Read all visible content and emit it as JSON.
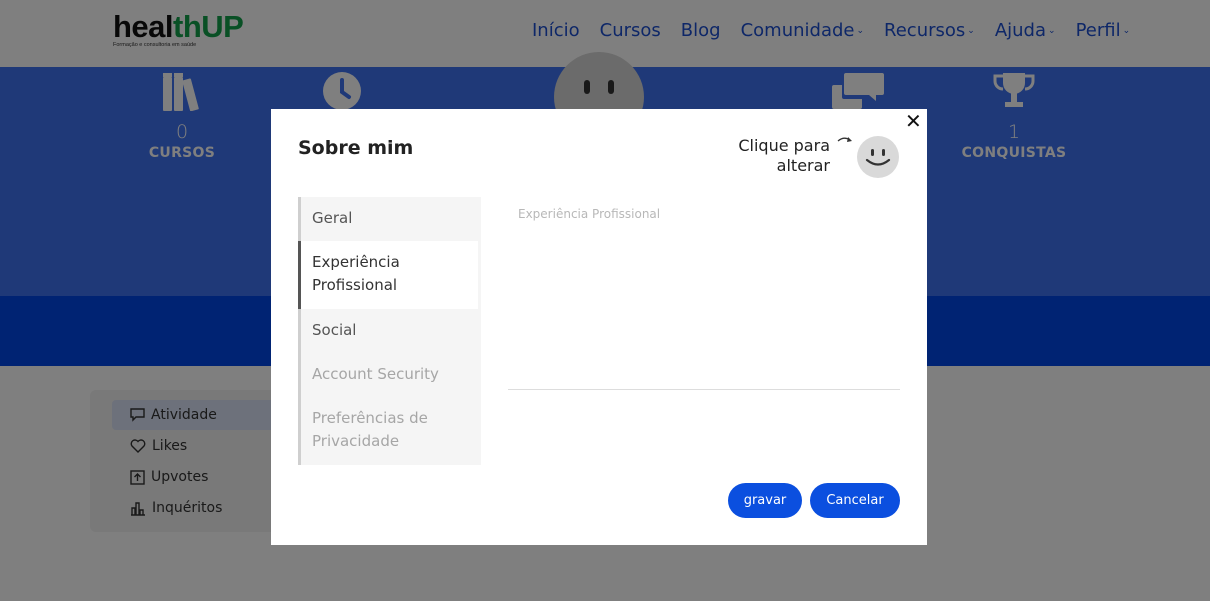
{
  "header": {
    "logo_part1": "heal",
    "logo_part2": "th",
    "logo_part3": "UP",
    "logo_tagline": "Formação e consultoria em saúde",
    "nav": [
      {
        "label": "Início",
        "dropdown": false
      },
      {
        "label": "Cursos",
        "dropdown": false
      },
      {
        "label": "Blog",
        "dropdown": false
      },
      {
        "label": "Comunidade",
        "dropdown": true
      },
      {
        "label": "Recursos",
        "dropdown": true
      },
      {
        "label": "Ajuda",
        "dropdown": true
      },
      {
        "label": "Perfil",
        "dropdown": true
      }
    ]
  },
  "stats": {
    "courses": {
      "value": "0",
      "label": "CURSOS",
      "icon": "books-icon"
    },
    "time": {
      "icon": "clock-icon"
    },
    "forum": {
      "icon": "chat-bubbles-icon"
    },
    "achievements": {
      "value": "1",
      "label": "CONQUISTAS",
      "icon": "trophy-icon"
    }
  },
  "activity": {
    "items": [
      {
        "label": "Atividade",
        "icon": "comment-icon",
        "active": true
      },
      {
        "label": "Likes",
        "icon": "heart-icon",
        "active": false
      },
      {
        "label": "Upvotes",
        "icon": "upvote-icon",
        "active": false
      },
      {
        "label": "Inquéritos",
        "icon": "poll-icon",
        "active": false
      }
    ]
  },
  "modal": {
    "title": "Sobre mim",
    "avatar_hint_line1": "Clique para",
    "avatar_hint_line2": "alterar",
    "tabs": [
      {
        "label": "Geral",
        "state": "normal"
      },
      {
        "label": "Experiência Profissional",
        "state": "active"
      },
      {
        "label": "Social",
        "state": "normal"
      },
      {
        "label": "Account Security",
        "state": "disabled"
      },
      {
        "label": "Preferências de Privacidade",
        "state": "disabled"
      }
    ],
    "textarea_placeholder": "Experiência Profissional",
    "textarea_value": "",
    "save_label": "gravar",
    "cancel_label": "Cancelar",
    "close_glyph": "✕"
  },
  "colors": {
    "primary": "#0b4fdf",
    "hero": "#3f73f0",
    "band": "#0047e6",
    "logo_green": "#13a04b"
  }
}
